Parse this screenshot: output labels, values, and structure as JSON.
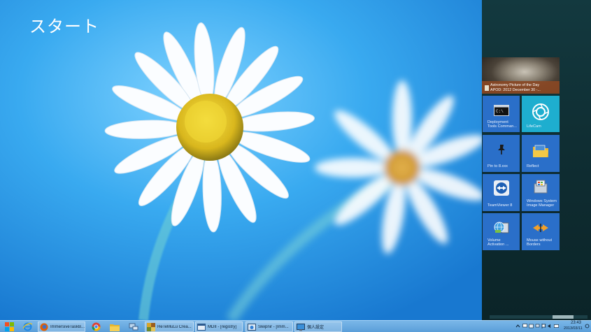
{
  "start": {
    "title": "スタート",
    "tiles": [
      {
        "label": "Astronomy Picture of the Day",
        "sub": "APOD: 2012 December 30 -...",
        "icon": "astronomy-photo"
      },
      {
        "label": "Deployment Tools Comman...",
        "icon": "command-prompt-icon"
      },
      {
        "label": "LifeCam",
        "icon": "camera-lens-icon"
      },
      {
        "label": "Pin to 8.xxx",
        "icon": "pin-icon"
      },
      {
        "label": "Reflect",
        "icon": "folder-icon"
      },
      {
        "label": "TeamViewer 8",
        "icon": "teamviewer-icon"
      },
      {
        "label": "Windows System Image Manager",
        "icon": "system-image-icon"
      },
      {
        "label": "Volume Activation ...",
        "icon": "globe-server-icon"
      },
      {
        "label": "Mouse without Borders",
        "icon": "mouse-arrows-icon"
      }
    ]
  },
  "taskbar": {
    "buttons": [
      {
        "label": "ImmersiveTaskB..."
      },
      {
        "label": "HeTeMuLu Crea..."
      },
      {
        "label": "MDII - [registry]"
      },
      {
        "label": "Sleipnir - [Imm..."
      },
      {
        "label": "個人設定"
      }
    ],
    "clock": {
      "time": "23:43",
      "date": "2013/03/11"
    }
  },
  "colors": {
    "tile_blue": "#2a6fc9",
    "tile_cyan": "#1eaecf",
    "apod_bar": "#8a4824",
    "panel_bg": "#0f2e33",
    "taskbar": "#5a9ed9"
  }
}
